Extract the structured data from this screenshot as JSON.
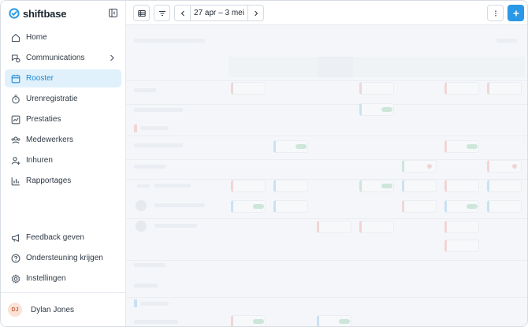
{
  "brand": {
    "name": "shiftbase"
  },
  "nav": {
    "items": [
      {
        "label": "Home",
        "icon": "home-icon"
      },
      {
        "label": "Communications",
        "icon": "chat-icon",
        "has_submenu": true
      },
      {
        "label": "Rooster",
        "icon": "calendar-icon",
        "active": true
      },
      {
        "label": "Urenregistratie",
        "icon": "stopwatch-icon"
      },
      {
        "label": "Prestaties",
        "icon": "chart-box-icon"
      },
      {
        "label": "Medewerkers",
        "icon": "users-icon"
      },
      {
        "label": "Inhuren",
        "icon": "user-add-icon"
      },
      {
        "label": "Rapportages",
        "icon": "bar-chart-icon"
      }
    ],
    "bottom": [
      {
        "label": "Feedback geven",
        "icon": "megaphone-icon"
      },
      {
        "label": "Ondersteuning krijgen",
        "icon": "help-icon"
      },
      {
        "label": "Instellingen",
        "icon": "gear-icon"
      }
    ]
  },
  "user": {
    "initials": "DJ",
    "name": "Dylan Jones"
  },
  "toolbar": {
    "date_range": "27 apr – 3 mei",
    "add_label": "+"
  },
  "colors": {
    "accent": "#2a98e6",
    "active_bg": "#e0f1fc",
    "active_text": "#1a8ad4",
    "shift_red": "#e4655f",
    "shift_blue": "#3b9be0",
    "shift_green": "#49b26b"
  }
}
